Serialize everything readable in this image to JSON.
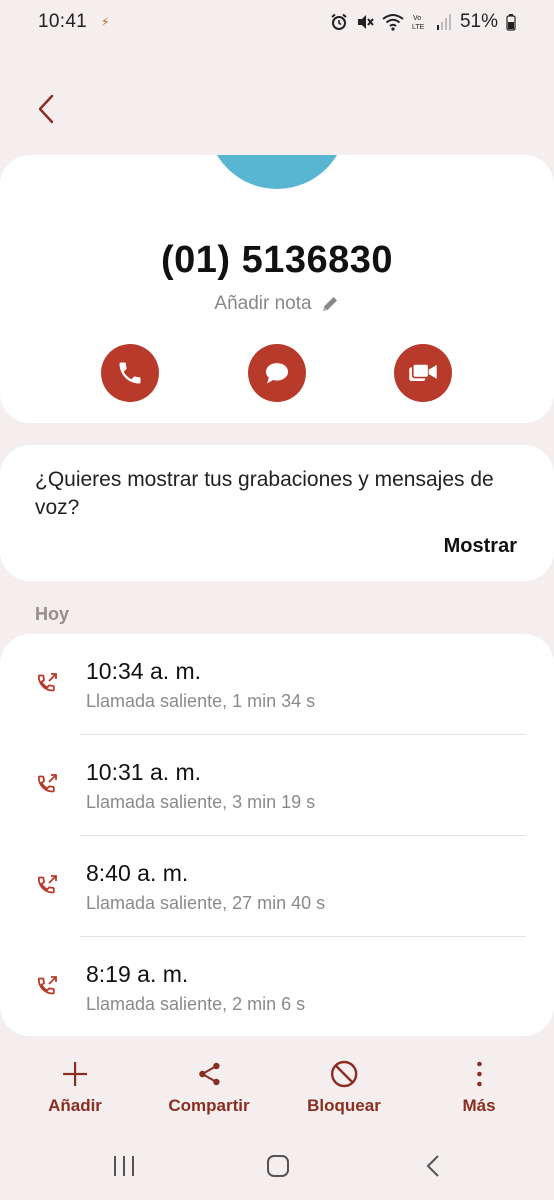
{
  "status_bar": {
    "time": "10:41",
    "battery": "51%"
  },
  "contact": {
    "number": "(01) 5136830",
    "add_note": "Añadir nota"
  },
  "voice_prompt": {
    "text": "¿Quieres mostrar tus grabaciones y mensajes de voz?",
    "action": "Mostrar"
  },
  "section": {
    "today": "Hoy"
  },
  "call_log": [
    {
      "time": "10:34 a. m.",
      "detail": "Llamada saliente, 1 min 34 s"
    },
    {
      "time": "10:31 a. m.",
      "detail": "Llamada saliente, 3 min 19 s"
    },
    {
      "time": "8:40 a. m.",
      "detail": "Llamada saliente, 27 min 40 s"
    },
    {
      "time": "8:19 a. m.",
      "detail": "Llamada saliente, 2 min 6 s"
    }
  ],
  "toolbar": {
    "add": "Añadir",
    "share": "Compartir",
    "block": "Bloquear",
    "more": "Más"
  },
  "colors": {
    "accent": "#b83a2b",
    "avatar": "#58b6d2",
    "label": "#8b2e22"
  }
}
